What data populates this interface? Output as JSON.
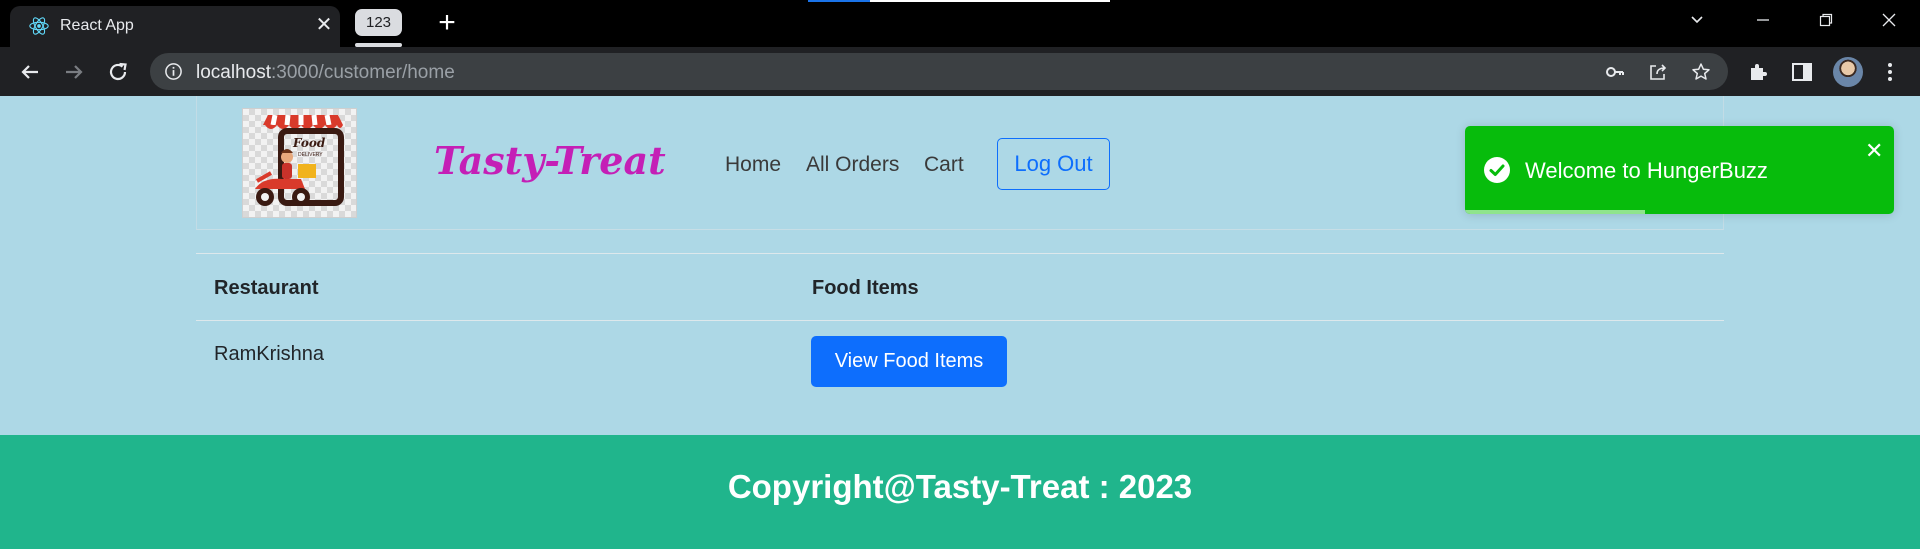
{
  "browser": {
    "tab_title": "React App",
    "tab_close": "✕",
    "tab_group_label": "123",
    "new_tab": "+",
    "url_host": "localhost",
    "url_path": ":3000/customer/home"
  },
  "navbar": {
    "brand": "Tasty-Treat",
    "links": [
      "Home",
      "All Orders",
      "Cart"
    ],
    "logout_label": "Log Out"
  },
  "table": {
    "headers": [
      "Restaurant",
      "Food Items"
    ],
    "rows": [
      {
        "restaurant": "RamKrishna",
        "action_label": "View Food Items"
      }
    ]
  },
  "footer": {
    "text": "Copyright@Tasty-Treat : 2023"
  },
  "toast": {
    "message": "Welcome to HungerBuzz",
    "close": "✕",
    "progress": 0.42
  },
  "colors": {
    "page_bg": "#add8e6",
    "brand": "#c41fb6",
    "primary": "#0d6efd",
    "footer": "#20b58c",
    "toast": "#07bc0c"
  },
  "icons": {
    "tab": "react-logo-icon",
    "toast": "check-circle-icon"
  }
}
